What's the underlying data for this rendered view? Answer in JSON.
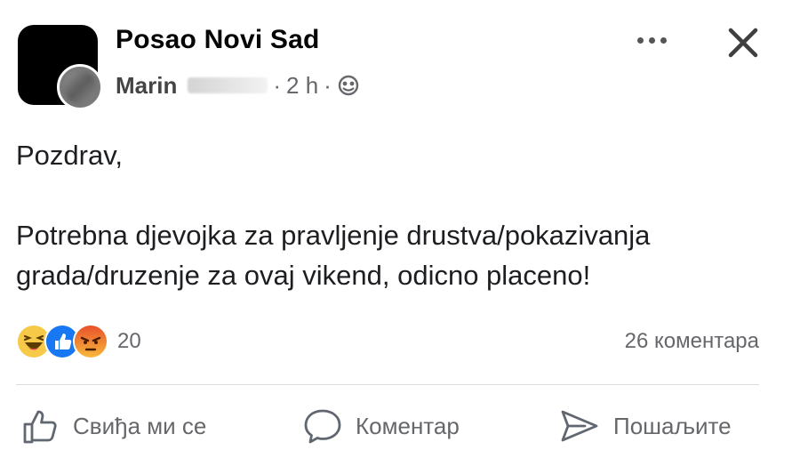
{
  "post": {
    "group_name": "Posao Novi Sad",
    "author": "Marin",
    "time": "2 h",
    "separator": "·",
    "visibility_icon": "globe-icon",
    "more_icon": "more-dots-icon",
    "close_icon": "close-icon",
    "text_lines": [
      "Pozdrav,",
      "Potrebna djevojka za pravljenje drustva/pokazivanja",
      "grada/druzenje za ovaj vikend, odicno placeno!"
    ]
  },
  "reactions": {
    "icons": [
      "haha-reaction-icon",
      "like-reaction-icon",
      "angry-reaction-icon"
    ],
    "count": "20",
    "comments": "26 коментара"
  },
  "actions": {
    "like_label": "Свиђа ми се",
    "comment_label": "Коментар",
    "share_label": "Пошаљите"
  },
  "colors": {
    "like_blue": "#1877f2",
    "haha_yellow": "#f7c948",
    "angry_orange": "#f0643c",
    "muted_text": "#65676b"
  }
}
